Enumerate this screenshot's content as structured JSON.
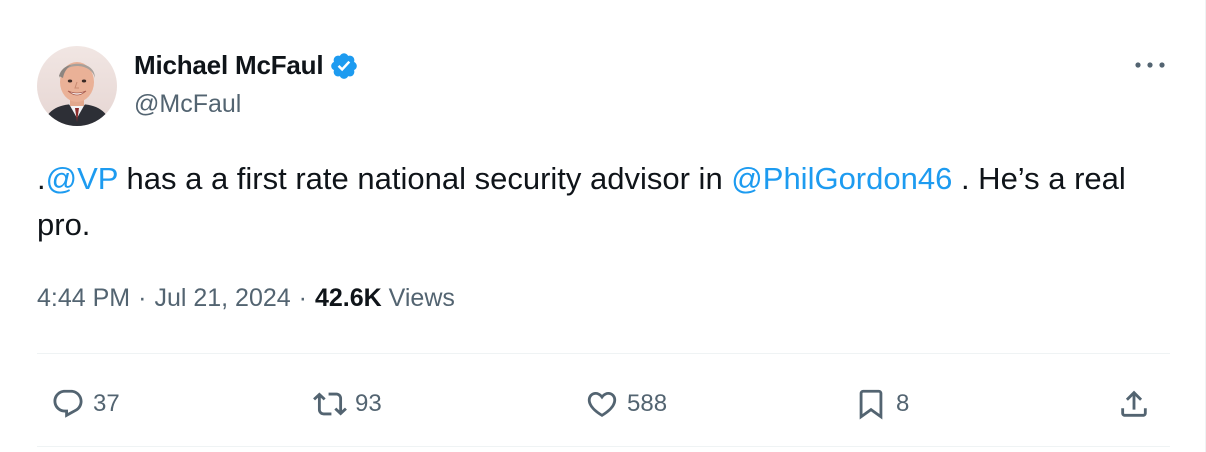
{
  "author": {
    "name": "Michael McFaul",
    "handle": "@McFaul",
    "verified": true
  },
  "tweet": {
    "prefix": ".",
    "mention1": "@VP",
    "text_middle": " has a a first rate national security advisor in ",
    "mention2": "@PhilGordon46",
    "text_end": " . He’s a real pro."
  },
  "meta": {
    "time": "4:44 PM",
    "separator1": "·",
    "date": "Jul 21, 2024",
    "separator2": "·",
    "views_count": "42.6K",
    "views_label": "Views"
  },
  "actions": {
    "replies": "37",
    "reposts": "93",
    "likes": "588",
    "bookmarks": "8"
  },
  "colors": {
    "accent": "#1d9bf0",
    "text": "#0f1419",
    "secondary": "#536471",
    "divider": "#eff3f4"
  },
  "icons": [
    "verified-badge-icon",
    "more-icon",
    "reply-icon",
    "repost-icon",
    "like-icon",
    "bookmark-icon",
    "share-icon"
  ]
}
